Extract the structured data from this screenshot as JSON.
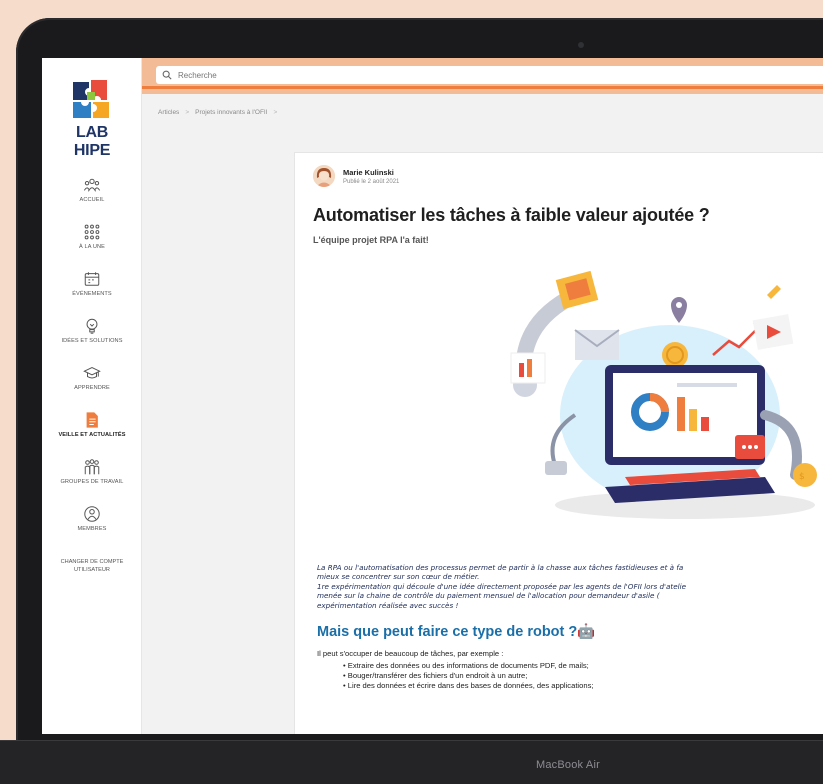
{
  "device": {
    "label": "MacBook Air"
  },
  "sidebar": {
    "logo_text": "LAB HIPE",
    "items": [
      {
        "label": "ACCUEIL",
        "icon": "people-icon"
      },
      {
        "label": "À LA UNE",
        "icon": "grid-icon"
      },
      {
        "label": "ÉVÉNEMENTS",
        "icon": "calendar-icon"
      },
      {
        "label": "IDÉES ET SOLUTIONS",
        "icon": "lightbulb-icon"
      },
      {
        "label": "APPRENDRE",
        "icon": "graduation-cap-icon"
      },
      {
        "label": "VEILLE ET ACTUALITÉS",
        "icon": "document-icon",
        "active": true
      },
      {
        "label": "GROUPES DE TRAVAIL",
        "icon": "group-icon"
      },
      {
        "label": "MEMBRES",
        "icon": "member-icon"
      }
    ],
    "switch_account": "CHANGER DE COMPTE UTILISATEUR"
  },
  "search": {
    "placeholder": "Recherche"
  },
  "breadcrumb": {
    "items": [
      "Articles",
      "Projets innovants à l'OFII"
    ],
    "separator": ">"
  },
  "article": {
    "author_name": "Marie Kulinski",
    "published": "Publié le 2 août 2021",
    "title": "Automatiser les tâches à faible valeur ajoutée ?",
    "subtitle": "L'équipe projet RPA l'a fait!",
    "paragraph_lines": [
      "La RPA ou l'automatisation des processus permet de partir à la chasse aux tâches fastidieuses et à fa",
      "mieux se concentrer sur son cœur de métier.",
      "1re expérimentation qui découle d'une idée directement proposée par les agents de l'OFII lors d'atelie",
      "menée sur la chaine de contrôle du paiement mensuel de l'allocation pour demandeur d'asile (",
      "expérimentation réalisée avec succès !"
    ],
    "section_title": "Mais que peut faire ce type de robot ?",
    "section_emoji": "🤖",
    "list_intro": "Il peut s'occuper de beaucoup de tâches, par exemple :",
    "bullets": [
      "Extraire des données ou des informations de documents PDF, de mails;",
      "Bouger/transférer des fichiers d'un endroit à un autre;",
      "Lire des données et écrire dans des bases de données, des applications;"
    ]
  },
  "colors": {
    "accent": "#ee7d3e",
    "topbar": "#f3bb96",
    "brand_navy": "#1e3566",
    "section_blue": "#1b6fa8",
    "page_background": "#f6dccb"
  }
}
